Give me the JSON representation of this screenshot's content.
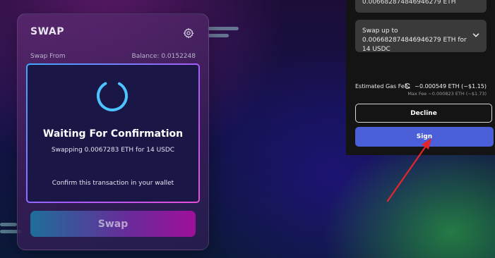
{
  "swap_card": {
    "title": "SWAP",
    "swap_from_label": "Swap From",
    "balance_label": "Balance: 0.0152248",
    "swap_button_label": "Swap"
  },
  "modal": {
    "title": "Waiting For Confirmation",
    "subtitle": "Swapping 0.0067283 ETH for 14 USDC",
    "hint": "Confirm this transaction in your wallet"
  },
  "wallet": {
    "top_field_value": "0.006682874846946279 ETH",
    "swap_summary": "Swap up to 0.006682874846946279 ETH for 14 USDC",
    "gas_label": "Estimated Gas Fee",
    "gas_value": "~0.000549 ETH (~$1.15)",
    "gas_max": "Max Fee ~0.000823 ETH (~$1.73)",
    "decline_label": "Decline",
    "sign_label": "Sign"
  },
  "colors": {
    "sign": "#4b5fd8",
    "spinner": "#4cc4ff",
    "annotation_arrow": "#e3262b"
  }
}
